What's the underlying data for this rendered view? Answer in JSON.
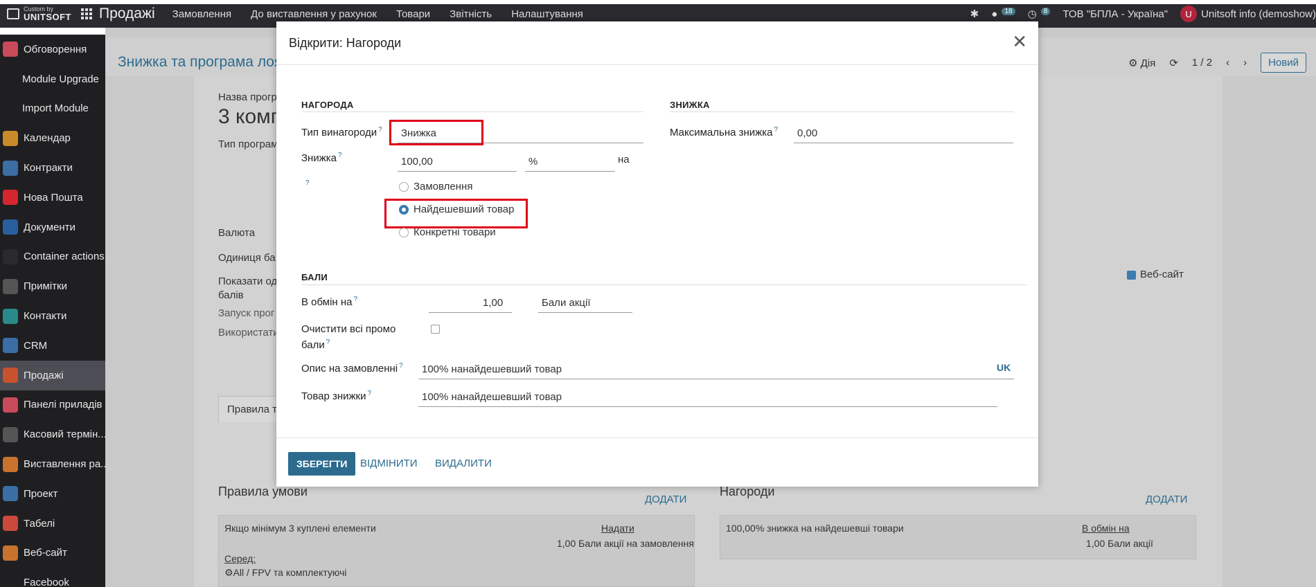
{
  "topbar": {
    "brand_small": "Custom by",
    "brand_big": "UNITSOFT",
    "app_name": "Продажі",
    "menu": [
      "Замовлення",
      "До виставлення у рахунок",
      "Товари",
      "Звітність",
      "Налаштування"
    ],
    "chat_count": "18",
    "activity_count": "8",
    "company": "ТОВ \"БПЛА - Україна\"",
    "avatar_letter": "U",
    "user": "Unitsoft info (demoshow)"
  },
  "sidebar": {
    "items": [
      {
        "label": "Обговорення",
        "icon": "chat-icon",
        "color": "#c94a5a"
      },
      {
        "label": "Module Upgrade",
        "icon": "",
        "color": ""
      },
      {
        "label": "Import Module",
        "icon": "",
        "color": ""
      },
      {
        "label": "Календар",
        "icon": "calendar-icon",
        "color": "#c98a2a"
      },
      {
        "label": "Контракти",
        "icon": "contract-icon",
        "color": "#3a6ea5"
      },
      {
        "label": "Нова Пошта",
        "icon": "nova-poshta-icon",
        "color": "#d4262e"
      },
      {
        "label": "Документи",
        "icon": "documents-icon",
        "color": "#2a5f9e"
      },
      {
        "label": "Container actions",
        "icon": "container-icon",
        "color": "#2a2a2e"
      },
      {
        "label": "Примітки",
        "icon": "notes-icon",
        "color": "#555"
      },
      {
        "label": "Контакти",
        "icon": "contacts-icon",
        "color": "#2a8a8a"
      },
      {
        "label": "CRM",
        "icon": "crm-icon",
        "color": "#3a6ea5"
      },
      {
        "label": "Продажі",
        "icon": "sales-icon",
        "color": "#c9522e"
      },
      {
        "label": "Панелі приладів",
        "icon": "dashboard-icon",
        "color": "#c94a5a"
      },
      {
        "label": "Касовий термін...",
        "icon": "pos-icon",
        "color": "#555"
      },
      {
        "label": "Виставлення ра...",
        "icon": "invoicing-icon",
        "color": "#c9722e"
      },
      {
        "label": "Проект",
        "icon": "project-icon",
        "color": "#3a6ea5"
      },
      {
        "label": "Табелі",
        "icon": "timesheet-icon",
        "color": "#c94a3a"
      },
      {
        "label": "Веб-сайт",
        "icon": "website-icon",
        "color": "#c9722e"
      },
      {
        "label": "Facebook",
        "icon": "facebook-icon",
        "color": "#1f1f22"
      }
    ]
  },
  "background": {
    "breadcrumb": "Знижка та програма лоя",
    "action": "Дія",
    "pager": "1 / 2",
    "new_button": "Новий",
    "program_name_label": "Назва прогр",
    "program_name_value": "3 комп",
    "program_type_label": "Тип програм",
    "currency_label": "Валюта",
    "unit_label": "Одиниця ба",
    "show_label_1": "Показати од",
    "show_label_2": "балів",
    "launch_label": "Запуск прог",
    "use_label": "Використати",
    "website_label": "Веб-сайт",
    "tab_rules": "Правила та",
    "rules_title": "Правила умови",
    "rules_add": "ДОДАТИ",
    "rule_text": "Якщо мінімум 3 куплені елементи",
    "rule_grant": "Надати",
    "rule_points": "1,00 Бали акції на замовлення",
    "rule_among": "Серед:",
    "rule_category": "All / FPV та комплектуючі",
    "rewards_title": "Нагороди",
    "rewards_add": "ДОДАТИ",
    "reward_text": "100,00% знижка на найдешевші товари",
    "reward_exchange": "В обмін на",
    "reward_points": "1,00 Бали акції"
  },
  "modal": {
    "title": "Відкрити: Нагороди",
    "reward_section": "НАГОРОДА",
    "discount_section": "ЗНИЖКА",
    "reward_type_label": "Тип винагороди",
    "reward_type_value": "Знижка",
    "discount_label": "Знижка",
    "discount_value": "100,00",
    "discount_unit": "%",
    "on_label": "на",
    "max_discount_label": "Максимальна знижка",
    "max_discount_value": "0,00",
    "apply_options": [
      "Замовлення",
      "Найдешевший товар",
      "Конкретні товари"
    ],
    "apply_selected": "Найдешевший товар",
    "points_section": "БАЛИ",
    "exchange_label": "В обмін на",
    "exchange_value": "1,00",
    "exchange_unit": "Бали акції",
    "clear_points_label_1": "Очистити всі промо",
    "clear_points_label_2": "бали",
    "order_desc_label": "Опис на замовленні",
    "order_desc_value": "100% нанайдешевший товар",
    "lang": "UK",
    "discount_product_label": "Товар знижки",
    "discount_product_value": "100% нанайдешевший товар",
    "save": "ЗБЕРЕГТИ",
    "cancel": "ВІДМІНИТИ",
    "delete": "ВИДАЛИТИ"
  }
}
